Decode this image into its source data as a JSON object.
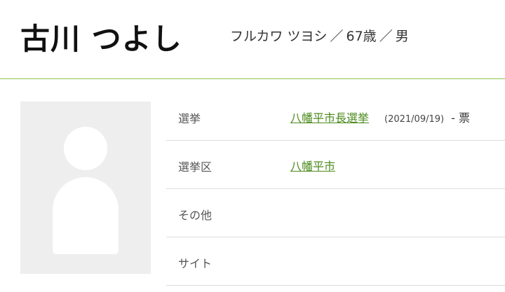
{
  "candidate": {
    "name": "古川 つよし",
    "kana": "フルカワ ツヨシ",
    "age": "67歳",
    "gender": "男",
    "separator": "／"
  },
  "details": {
    "election": {
      "label": "選挙",
      "name": "八幡平市長選挙",
      "date": "(2021/09/19)",
      "votes": "- 票"
    },
    "district": {
      "label": "選挙区",
      "value": "八幡平市"
    },
    "other": {
      "label": "その他",
      "value": ""
    },
    "site": {
      "label": "サイト",
      "value": ""
    }
  },
  "colors": {
    "accent_line": "#8bc34a",
    "link": "#4a8a1c",
    "avatar_bg": "#eeeeee"
  }
}
